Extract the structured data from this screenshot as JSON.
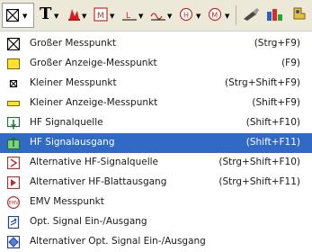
{
  "toolbar": {
    "text_tool_label": "T",
    "buttons": [
      {
        "name": "measure-point-tool",
        "icon": "measure-point-icon"
      },
      {
        "name": "text-tool",
        "icon": "text-icon"
      },
      {
        "name": "red-symbol-tool",
        "icon": "red-symbol-icon"
      },
      {
        "name": "m-symbol-tool",
        "icon": "m-symbol-icon"
      },
      {
        "name": "l-symbol-tool",
        "icon": "l-symbol-icon"
      },
      {
        "name": "wave-symbol-tool",
        "icon": "wave-symbol-icon"
      },
      {
        "name": "h-symbol-tool",
        "icon": "h-symbol-icon"
      },
      {
        "name": "circle-m-symbol-tool",
        "icon": "circle-m-symbol-icon"
      },
      {
        "name": "brush-tool",
        "icon": "brush-icon"
      },
      {
        "name": "chart-tool",
        "icon": "chart-icon"
      },
      {
        "name": "extra-tool",
        "icon": "extra-icon"
      }
    ]
  },
  "menu": {
    "items": [
      {
        "label": "Großer Messpunkt",
        "shortcut": "(Strg+F9)",
        "icon": "large-measure-point-icon",
        "selected": false
      },
      {
        "label": "Großer Anzeige-Messpunkt",
        "shortcut": "(F9)",
        "icon": "large-display-measure-point-icon",
        "selected": false
      },
      {
        "label": "Kleiner Messpunkt",
        "shortcut": "(Strg+Shift+F9)",
        "icon": "small-measure-point-icon",
        "selected": false
      },
      {
        "label": "Kleiner Anzeige-Messpunkt",
        "shortcut": "(Shift+F9)",
        "icon": "small-display-measure-point-icon",
        "selected": false
      },
      {
        "label": "HF Signalquelle",
        "shortcut": "(Shift+F10)",
        "icon": "hf-signal-source-icon",
        "selected": false
      },
      {
        "label": "HF Signalausgang",
        "shortcut": "(Shift+F11)",
        "icon": "hf-signal-output-icon",
        "selected": true
      },
      {
        "label": "Alternative HF-Signalquelle",
        "shortcut": "(Strg+Shift+F10)",
        "icon": "alt-hf-signal-source-icon",
        "selected": false
      },
      {
        "label": "Alternativer HF-Blattausgang",
        "shortcut": "(Strg+Shift+F11)",
        "icon": "alt-hf-sheet-output-icon",
        "selected": false
      },
      {
        "label": "EMV Messpunkt",
        "shortcut": "",
        "icon": "emv-measure-point-icon",
        "selected": false
      },
      {
        "label": "Opt. Signal Ein-/Ausgang",
        "shortcut": "",
        "icon": "optical-signal-io-icon",
        "selected": false
      },
      {
        "label": "Alternativer Opt. Signal Ein-/Ausgang",
        "shortcut": "",
        "icon": "alt-optical-signal-io-icon",
        "selected": false
      }
    ]
  },
  "colors": {
    "toolbar_bg": "#ece9d8",
    "selection": "#316ac5",
    "menu_text": "#1a1a1a"
  }
}
